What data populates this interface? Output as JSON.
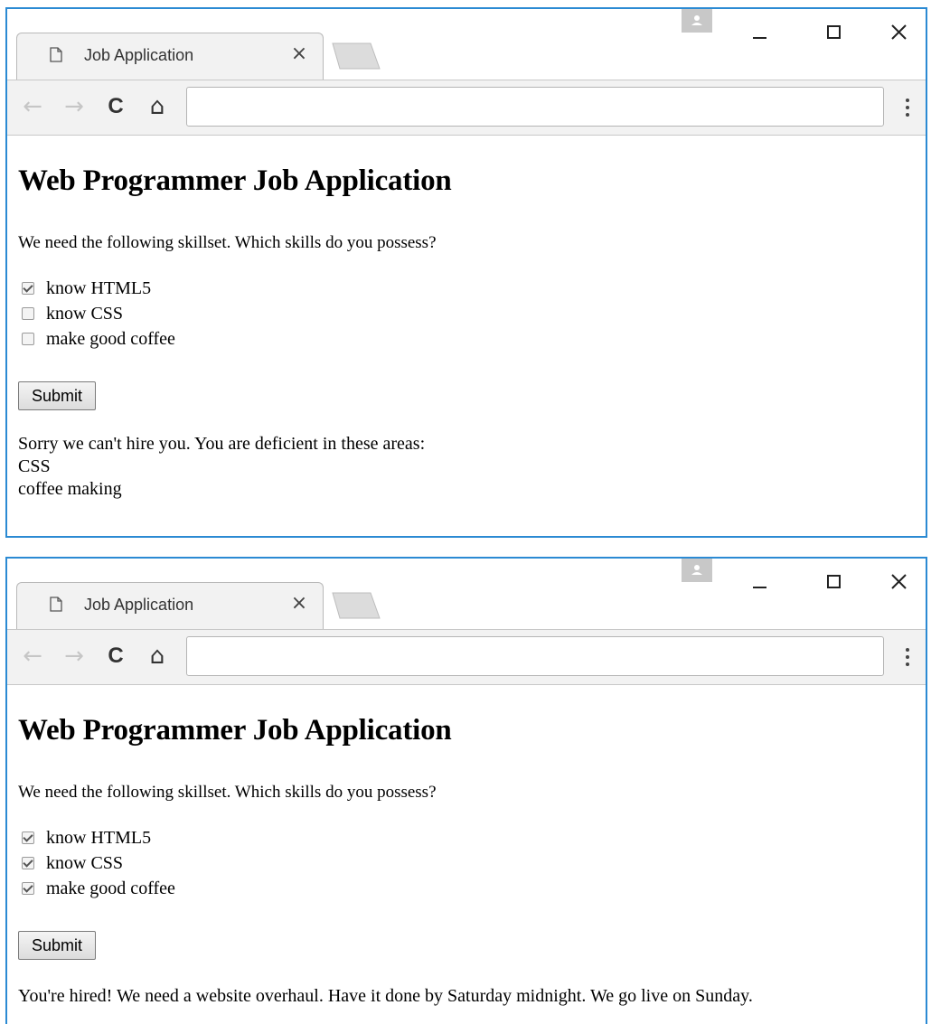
{
  "windows": [
    {
      "tab": {
        "title": "Job Application",
        "close": "×"
      },
      "nav": {
        "back": "←",
        "forward": "→",
        "reload": "C",
        "home": "⌂"
      },
      "address": "",
      "page": {
        "heading": "Web Programmer Job Application",
        "intro": "We need the following skillset. Which skills do you possess?",
        "skills": [
          {
            "label": "know HTML5",
            "checked": true
          },
          {
            "label": "know CSS",
            "checked": false
          },
          {
            "label": "make good coffee",
            "checked": false
          }
        ],
        "submit_label": "Submit",
        "result_lines": [
          "Sorry we can't hire you. You are deficient in these areas:",
          "CSS",
          "coffee making"
        ]
      }
    },
    {
      "tab": {
        "title": "Job Application",
        "close": "×"
      },
      "nav": {
        "back": "←",
        "forward": "→",
        "reload": "C",
        "home": "⌂"
      },
      "address": "",
      "page": {
        "heading": "Web Programmer Job Application",
        "intro": "We need the following skillset. Which skills do you possess?",
        "skills": [
          {
            "label": "know HTML5",
            "checked": true
          },
          {
            "label": "know CSS",
            "checked": true
          },
          {
            "label": "make good coffee",
            "checked": true
          }
        ],
        "submit_label": "Submit",
        "result_lines": [
          "You're hired! We need a website overhaul. Have it done by Saturday midnight. We go live on Sunday."
        ]
      }
    }
  ],
  "icons": {
    "document": "document-icon",
    "profile": "profile-icon",
    "minimize": "minimize-icon",
    "maximize": "maximize-icon",
    "close": "close-icon",
    "menu": "kebab-menu-icon"
  },
  "colors": {
    "window_border": "#2b8ad3",
    "chrome_bg": "#f2f2f2"
  }
}
